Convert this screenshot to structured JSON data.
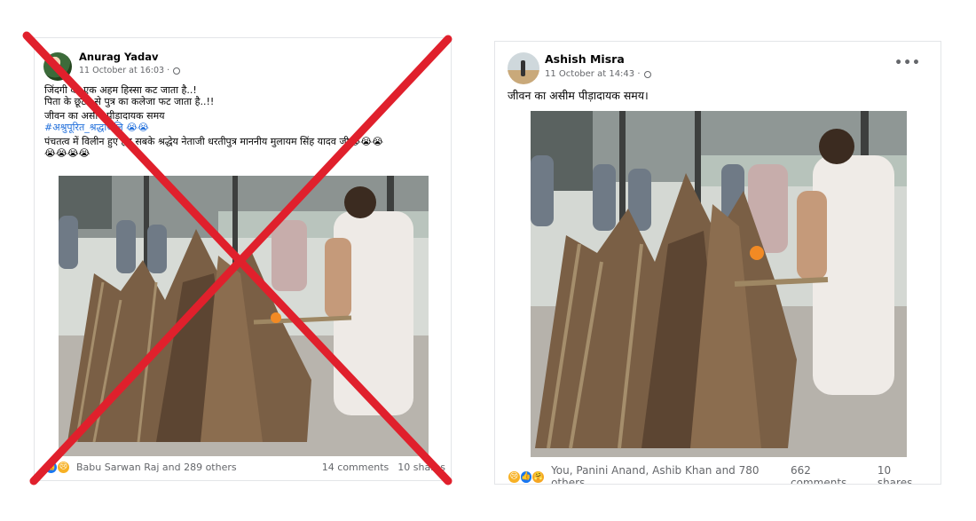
{
  "left_post": {
    "author": "Anurag Yadav",
    "timestamp": "11 October at 16:03 ·",
    "caption_lines": [
      "जिंदगी का एक अहम हिस्सा कट जाता है..!",
      "पिता के छूटने से पुत्र का कलेजा फट जाता है..!!",
      "जीवन का असीम पीड़ादायक समय"
    ],
    "hashtag": "#अश्रुपूरित_श्रद्धांजलि 😭😭",
    "caption_tail": "पंचतत्व में विलीन हुए हम सबके श्रद्धेय नेताजी धरतीपुत्र माननीय मुलायम सिंह यादव जी😭😭😭",
    "caption_tail2": "😭😭😭😭",
    "reactions": "Babu Sarwan Raj and 289 others",
    "comments": "14 comments",
    "shares": "10 shares",
    "struck_out": true,
    "cross_color": "#e0202c"
  },
  "right_post": {
    "author": "Ashish Misra",
    "timestamp": "11 October at 14:43 ·",
    "more_icon": "more-options-icon",
    "caption": "जीवन का असीम पीड़ादायक समय।",
    "reactions": "You, Panini Anand, Ashib Khan and 780 others",
    "comments": "662 comments",
    "shares": "10 shares"
  },
  "colors": {
    "link": "#216fdb",
    "meta_text": "#65676b",
    "like_blue": "#1877f2",
    "sad_yellow": "#f7b125"
  }
}
